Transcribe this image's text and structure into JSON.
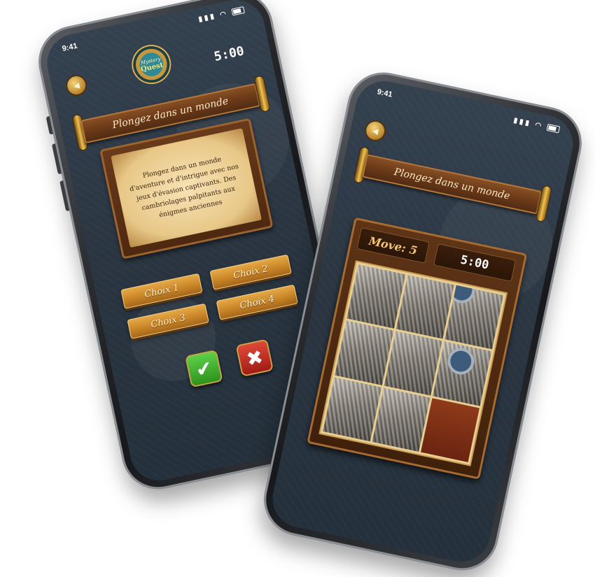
{
  "status_bar": {
    "time": "9:41",
    "signal_icon": "signal-icon",
    "wifi_icon": "wifi-icon",
    "battery_icon": "battery-icon"
  },
  "quiz_screen": {
    "logo": {
      "line1": "Mystery",
      "line2": "Quest"
    },
    "timer": "5:00",
    "banner_title": "Plongez dans un monde",
    "question_text": "Plongez dans un monde d'aventure et d'intrigue avec nos jeux d'évasion captivants. Des cambriolages palpitants aux énigmes anciennes",
    "choices": [
      "Choix 1",
      "Choix 2",
      "Choix 3",
      "Choix 4"
    ],
    "confirm_icon": "checkmark-icon",
    "cancel_icon": "close-icon",
    "confirm_glyph": "✔",
    "cancel_glyph": "✖"
  },
  "puzzle_screen": {
    "banner_title": "Plongez dans un monde",
    "move_label": "Move: 5",
    "timer": "5:00",
    "empty_tile_index": 8
  },
  "colors": {
    "wood": "#6c3a18",
    "gold_button": "#c98526",
    "screen_bg": "#2a3541",
    "confirm_green": "#2c8f1b",
    "cancel_red": "#9e1a14"
  }
}
